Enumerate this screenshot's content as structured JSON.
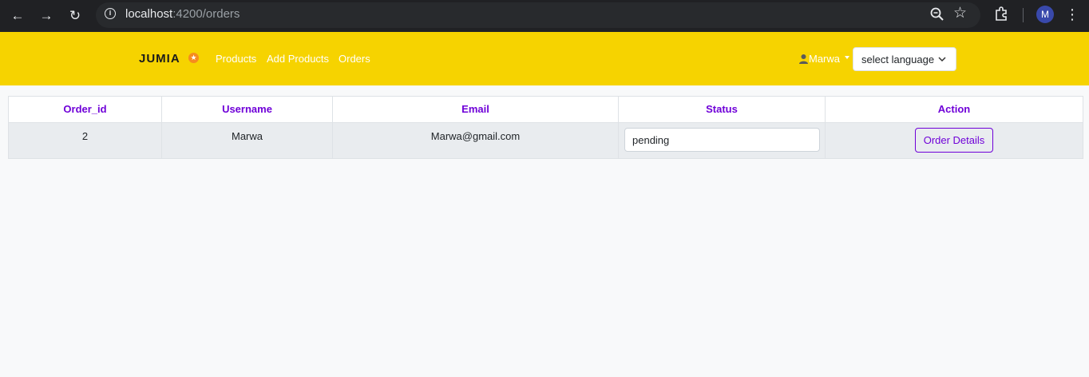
{
  "browser": {
    "url_host": "localhost",
    "url_path": ":4200/orders",
    "profile_initial": "M"
  },
  "navbar": {
    "brand": "JUMIA",
    "links": [
      "Products",
      "Add Products",
      "Orders"
    ],
    "user_name": "Marwa",
    "language_select": "select language",
    "background_color": "#f6d300"
  },
  "orders_table": {
    "columns": [
      "Order_id",
      "Username",
      "Email",
      "Status",
      "Action"
    ],
    "rows": [
      {
        "order_id": "2",
        "username": "Marwa",
        "email": "Marwa@gmail.com",
        "status": "pending",
        "action_label": "Order Details"
      }
    ],
    "header_color": "#6f00d8"
  }
}
